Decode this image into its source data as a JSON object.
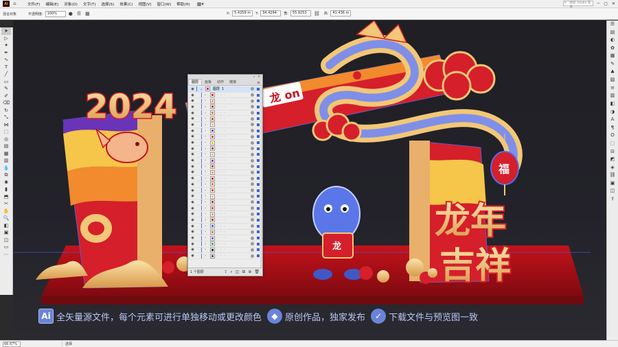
{
  "app": {
    "logo": "Ai",
    "home_icon": "home-icon"
  },
  "menu": [
    "文件(F)",
    "编辑(E)",
    "对象(O)",
    "文字(T)",
    "选择(S)",
    "效果(C)",
    "视图(V)",
    "窗口(W)",
    "帮助(H)"
  ],
  "window": {
    "search_placeholder": "搜索 Adobe 帮助"
  },
  "control_bar": {
    "object_label": "混合对象",
    "opacity_label": "不透明度:",
    "opacity_value": "100%",
    "x_label": "X:",
    "x_value": "5.4259 m",
    "y_label": "Y:",
    "y_value": "34.4294 ",
    "w_label": "宽:",
    "w_value": "55.9253 ",
    "h_label": "高:",
    "h_value": "41.436 m"
  },
  "layers_panel": {
    "tabs": [
      "图层",
      "画板",
      "动作",
      "链接"
    ],
    "parent_layer": {
      "name": "图层",
      "number": "1"
    },
    "child_count": 28,
    "child_swatches": [
      "#d7322c",
      "#e8a34a",
      "#c0392b",
      "#e67e22",
      "#d35400",
      "#f0c27b",
      "#7a4fb5",
      "#e74c3c",
      "#f1c40f",
      "#c0392b",
      "#ecb86a",
      "#8e44ad",
      "#d7322c",
      "#e8a34a",
      "#c0392b",
      "#e67e22",
      "#d35400",
      "#f0c27b",
      "#cc3333",
      "#e74c3c",
      "#ddb14a",
      "#c0392b",
      "#4a6fe0",
      "#e67e22",
      "#9b59b6",
      "#4caf50",
      "#222222",
      "#555555"
    ],
    "footer_label": "1 个图层"
  },
  "promo": {
    "badge_text": "Ai",
    "line1": "全矢量源文件，每个元素可进行单独移动或更改颜色",
    "line2": "原创作品，独家发布",
    "line3": "下载文件与预览图一致"
  },
  "artwork": {
    "year": "2024",
    "blessing_line1": "龙年",
    "blessing_line2": "吉祥",
    "lantern_char": "福",
    "drum_char": "龙",
    "banner_text": "龙",
    "banner_text_tail": "on"
  },
  "status": {
    "zoom": "66.67%",
    "tool": "选择"
  },
  "colors": {
    "red": "#d7222b",
    "gold": "#f2c777",
    "blue": "#4f6ef0",
    "purple": "#6a34b8"
  }
}
